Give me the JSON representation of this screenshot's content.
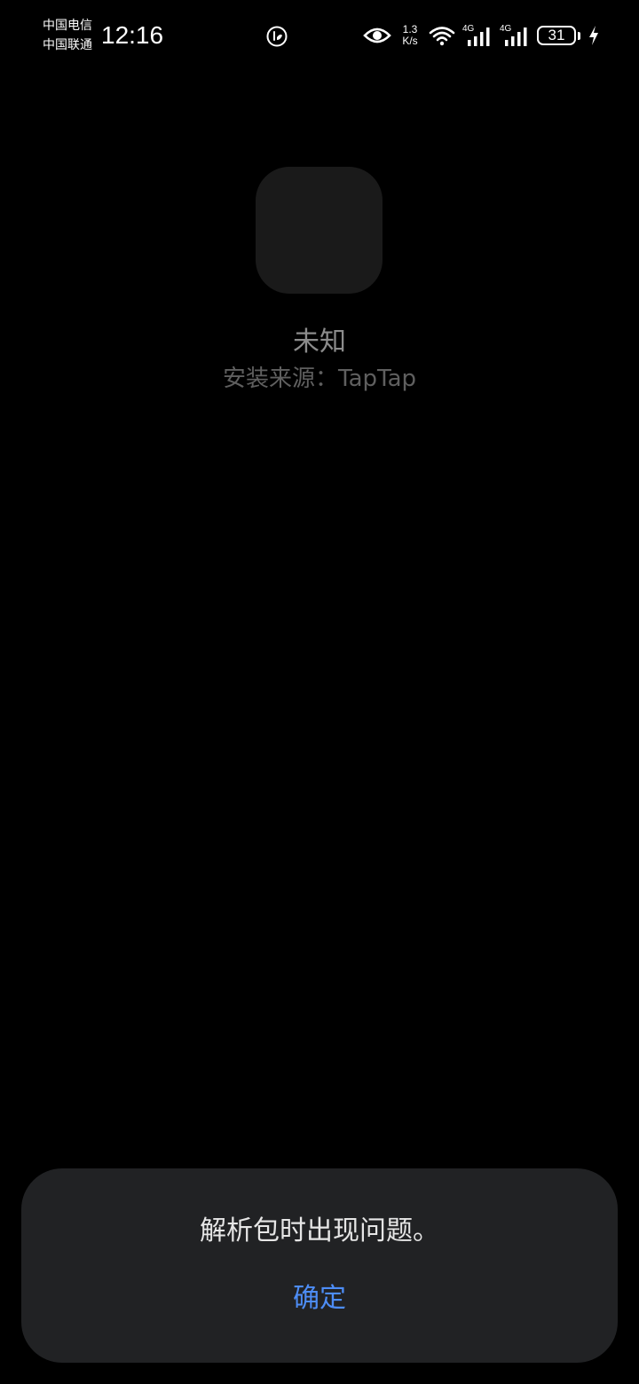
{
  "status_bar": {
    "carrier_1": "中国电信",
    "carrier_2": "中国联通",
    "time": "12:16",
    "net_speed_value": "1.3",
    "net_speed_unit": "K/s",
    "cell_1_type": "4G",
    "cell_2_type": "4G",
    "battery_level": "31",
    "icons": [
      "notification-badge-icon",
      "eye-icon",
      "wifi-icon",
      "cell-signal-icon",
      "battery-icon",
      "charging-bolt-icon"
    ]
  },
  "app": {
    "name": "未知",
    "source": "安装来源：TapTap"
  },
  "dialog": {
    "message": "解析包时出现问题。",
    "confirm_label": "确定"
  },
  "colors": {
    "background": "#000000",
    "dialog_background": "#212224",
    "accent": "#4d8df6",
    "app_icon_placeholder": "#1a1a1a"
  }
}
